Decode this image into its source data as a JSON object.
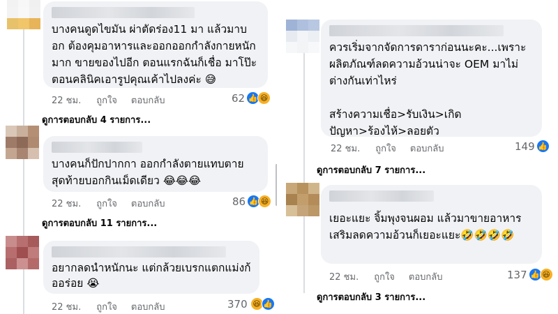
{
  "left_comments": [
    {
      "text": "บางคนดูดไขมัน ผ่าตัดร่อง11 มา แล้วมาบอก ต้องคุมอาหารและออกออกกำลังกายหนักมาก ขายของไปอีก ตอนแรกฉันก็เชื่อ มาโป๊ะตอนคลินิคเอารูปคุณเค้าไปลงค่ะ 😅",
      "time": "22 ชม.",
      "like": "ถูกใจ",
      "reply": "ตอบกลับ",
      "reaction_count": "62",
      "view_replies": "ดูการตอบกลับ 4 รายการ..."
    },
    {
      "text": "บางคนก็ปักปากกา ออกกำลังตายแทบตาย สุดท้ายบอกกินเม็ดเดียว 😂😂😂",
      "time": "22 ชม.",
      "like": "ถูกใจ",
      "reply": "ตอบกลับ",
      "reaction_count": "86",
      "view_replies": "ดูการตอบกลับ 11 รายการ..."
    },
    {
      "text": "อยากลดนำหนักนะ แต่กล้วยเบรกแตกแม่งก้ออร่อย 😭",
      "time": "22 ชม.",
      "like": "ถูกใจ",
      "reply": "ตอบกลับ",
      "reaction_count": "370"
    }
  ],
  "right_comments": [
    {
      "text": "ควรเริ่มจากจัดการดาราก่อนนะคะ...เพราะผลิตภัณฑ์ลดความอ้วนน่าจะ OEM มาไม่ต่างกันเท่าไหร่\n\nสร้างความเชื่อ>รับเงิน>เกิดปัญหา>ร้องไห้>ลอยตัว",
      "time": "22 ชม.",
      "like": "ถูกใจ",
      "reply": "ตอบกลับ",
      "reaction_count": "149",
      "view_replies": "ดูการตอบกลับ 7 รายการ..."
    },
    {
      "text": "เยอะแยะ จิ้มพุงจนผอม แล้วมาขายอาหารเสริมลดความอ้วนก็เยอะแยะ🤣🤣🤣🤣",
      "time": "22 ชม.",
      "like": "ถูกใจ",
      "reply": "ตอบกลับ",
      "reaction_count": "137",
      "view_replies": "ดูการตอบกลับ 3 รายการ..."
    }
  ],
  "reaction_icons": {
    "like": "👍",
    "haha": "😆"
  },
  "colors": {
    "bubble": "#f0f2f5",
    "meta_text": "#65676b",
    "like_blue": "#1877f2",
    "haha_yellow": "#f7b125"
  }
}
